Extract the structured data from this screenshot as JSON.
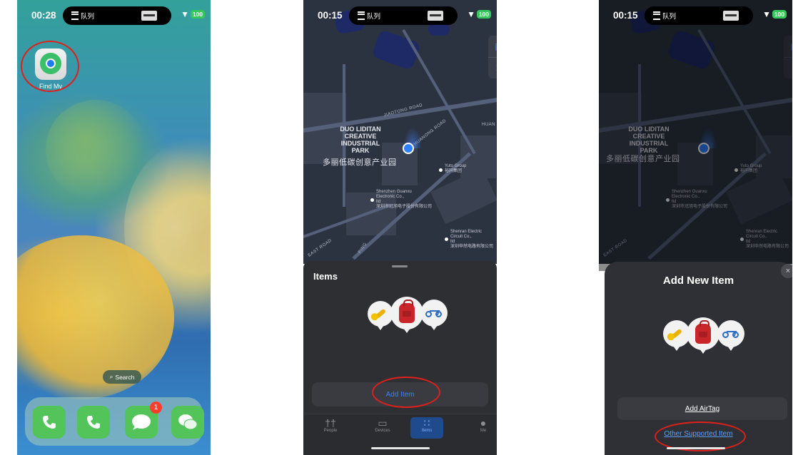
{
  "phone1": {
    "status": {
      "time": "00:28",
      "island_label": "队列",
      "battery": "100"
    },
    "apps": {
      "find_my_label": "Find My"
    },
    "search_label": "Search",
    "dock_badge": "1"
  },
  "phone2": {
    "status": {
      "time": "00:15",
      "island_label": "队列",
      "battery": "100"
    },
    "map": {
      "park_name_en": "DUO LIDITAN\nCREATIVE\nINDUSTRIAL\nPARK",
      "park_name_cn": "多丽低碳创意产业园",
      "road_huanqing": "HUANQING ROAD",
      "road_huang": "HUAN",
      "road_east": "EAST ROAD",
      "road_ping": "PING",
      "road_huanong": "HUANONG ROAD",
      "road_jiaotong": "JIAOTONG ROAD",
      "poi_yuto": "Yuto Group\n裕同集团",
      "poi_guanxu": "Shenzhen Guanxu\nElectronic Co.,\nltd\n深圳市冠旭电子股份有限公司",
      "poi_shenran": "Shenran Electric\nCircuit Co.,\nltd\n深圳申然电路有限公司"
    },
    "sheet": {
      "title": "Items",
      "add_button": "Add Item"
    },
    "tabs": [
      {
        "label": "People",
        "icon": "people-icon"
      },
      {
        "label": "Devices",
        "icon": "devices-icon"
      },
      {
        "label": "Items",
        "icon": "items-icon"
      },
      {
        "label": "Me",
        "icon": "me-icon"
      }
    ]
  },
  "phone3": {
    "status": {
      "time": "00:15",
      "island_label": "队列",
      "battery": "100"
    },
    "map": {
      "park_name_en": "DUO LIDITAN\nCREATIVE\nINDUSTRIAL\nPARK",
      "park_name_cn": "多丽低碳创意产业园",
      "poi_yuto": "Yuto Group\n裕同集团",
      "poi_guanxu": "Shenzhen Guanxu\nElectronic Co.,\nltd\n深圳市冠旭电子股份有限公司",
      "poi_shenran": "Shenran Electric\nCircuit Co.,\nltd\n深圳申然电路有限公司",
      "road_east": "EAST ROAD"
    },
    "sheet": {
      "title": "Add New Item",
      "add_airtag": "Add AirTag",
      "other_item": "Other Supported Item",
      "close": "×"
    }
  },
  "colors": {
    "annotation_red": "#e0201b",
    "accent_blue": "#3b82f6",
    "sheet_bg": "#2e2f33"
  }
}
